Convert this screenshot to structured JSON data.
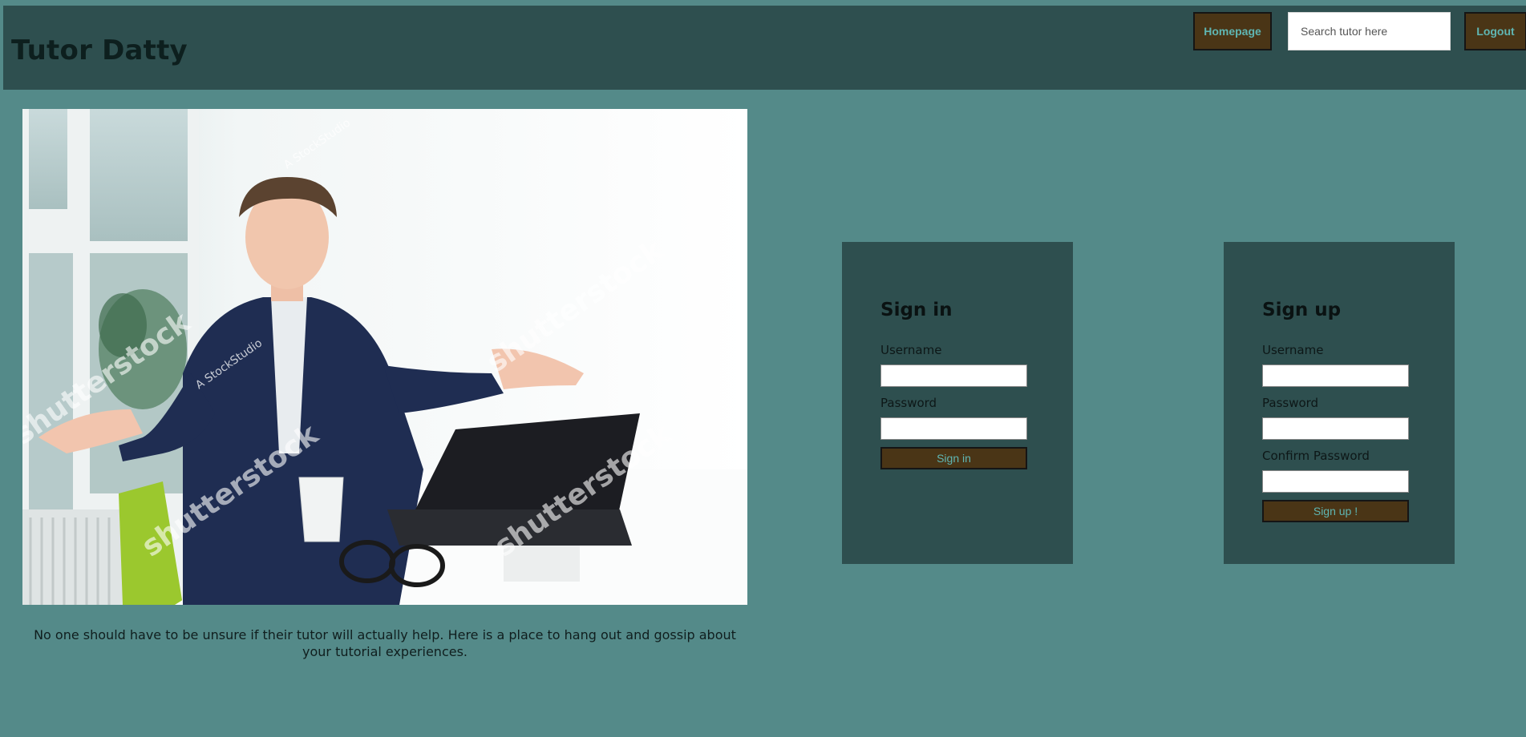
{
  "header": {
    "brand": "Tutor Datty",
    "homepage_label": "Homepage",
    "search_placeholder": "Search tutor here",
    "logout_label": "Logout"
  },
  "hero": {
    "caption": "No one should have to be unsure if their tutor will actually help. Here is a place to hang out and gossip about your tutorial experiences.",
    "watermark_text": "shutterstock",
    "credit_text": "A StockStudio"
  },
  "signin": {
    "title": "Sign in",
    "username_label": "Username",
    "password_label": "Password",
    "submit_label": "Sign in"
  },
  "signup": {
    "title": "Sign up",
    "username_label": "Username",
    "password_label": "Password",
    "confirm_label": "Confirm Password",
    "submit_label": "Sign up !"
  },
  "colors": {
    "page_bg": "#548a89",
    "header_bg": "#2e4f4f",
    "card_bg": "#2e4f4f",
    "button_bg": "#4a3516",
    "button_text": "#5fb6b3"
  }
}
